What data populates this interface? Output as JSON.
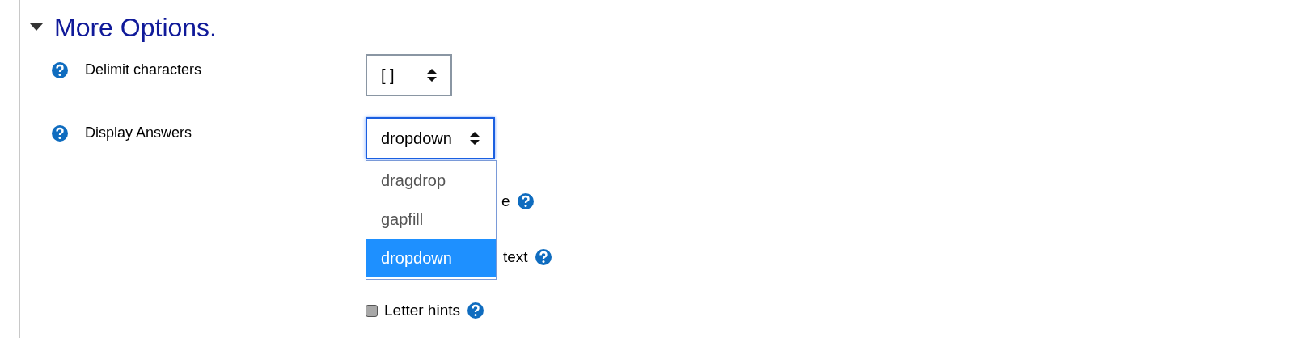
{
  "section": {
    "title": "More Options.",
    "expanded": true
  },
  "fields": [
    {
      "label": "Delimit characters",
      "value": "[ ]",
      "focused": false
    },
    {
      "label": "Display Answers",
      "value": "dropdown",
      "focused": true
    }
  ],
  "dropdown_options": [
    {
      "label": "dragdrop",
      "selected": false
    },
    {
      "label": "gapfill",
      "selected": false
    },
    {
      "label": "dropdown",
      "selected": true
    }
  ],
  "checkbox_rows": [
    {
      "kind": "partial",
      "label": "e"
    },
    {
      "kind": "partial",
      "label": "text"
    },
    {
      "kind": "checkbox",
      "label": "Letter hints",
      "checked": false
    }
  ]
}
